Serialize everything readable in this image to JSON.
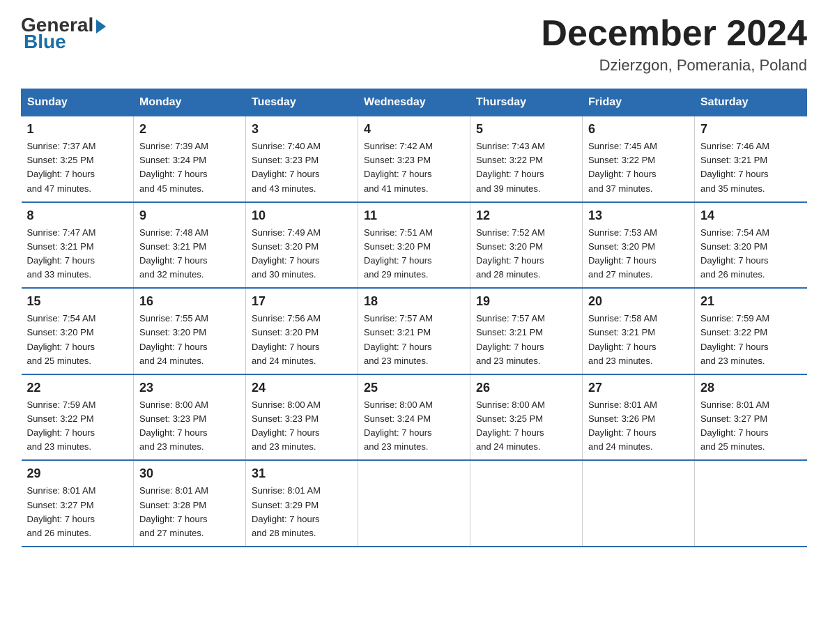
{
  "logo": {
    "general": "General",
    "blue": "Blue"
  },
  "header": {
    "month": "December 2024",
    "location": "Dzierzgon, Pomerania, Poland"
  },
  "weekdays": [
    "Sunday",
    "Monday",
    "Tuesday",
    "Wednesday",
    "Thursday",
    "Friday",
    "Saturday"
  ],
  "weeks": [
    [
      {
        "day": "1",
        "sunrise": "7:37 AM",
        "sunset": "3:25 PM",
        "daylight": "7 hours and 47 minutes."
      },
      {
        "day": "2",
        "sunrise": "7:39 AM",
        "sunset": "3:24 PM",
        "daylight": "7 hours and 45 minutes."
      },
      {
        "day": "3",
        "sunrise": "7:40 AM",
        "sunset": "3:23 PM",
        "daylight": "7 hours and 43 minutes."
      },
      {
        "day": "4",
        "sunrise": "7:42 AM",
        "sunset": "3:23 PM",
        "daylight": "7 hours and 41 minutes."
      },
      {
        "day": "5",
        "sunrise": "7:43 AM",
        "sunset": "3:22 PM",
        "daylight": "7 hours and 39 minutes."
      },
      {
        "day": "6",
        "sunrise": "7:45 AM",
        "sunset": "3:22 PM",
        "daylight": "7 hours and 37 minutes."
      },
      {
        "day": "7",
        "sunrise": "7:46 AM",
        "sunset": "3:21 PM",
        "daylight": "7 hours and 35 minutes."
      }
    ],
    [
      {
        "day": "8",
        "sunrise": "7:47 AM",
        "sunset": "3:21 PM",
        "daylight": "7 hours and 33 minutes."
      },
      {
        "day": "9",
        "sunrise": "7:48 AM",
        "sunset": "3:21 PM",
        "daylight": "7 hours and 32 minutes."
      },
      {
        "day": "10",
        "sunrise": "7:49 AM",
        "sunset": "3:20 PM",
        "daylight": "7 hours and 30 minutes."
      },
      {
        "day": "11",
        "sunrise": "7:51 AM",
        "sunset": "3:20 PM",
        "daylight": "7 hours and 29 minutes."
      },
      {
        "day": "12",
        "sunrise": "7:52 AM",
        "sunset": "3:20 PM",
        "daylight": "7 hours and 28 minutes."
      },
      {
        "day": "13",
        "sunrise": "7:53 AM",
        "sunset": "3:20 PM",
        "daylight": "7 hours and 27 minutes."
      },
      {
        "day": "14",
        "sunrise": "7:54 AM",
        "sunset": "3:20 PM",
        "daylight": "7 hours and 26 minutes."
      }
    ],
    [
      {
        "day": "15",
        "sunrise": "7:54 AM",
        "sunset": "3:20 PM",
        "daylight": "7 hours and 25 minutes."
      },
      {
        "day": "16",
        "sunrise": "7:55 AM",
        "sunset": "3:20 PM",
        "daylight": "7 hours and 24 minutes."
      },
      {
        "day": "17",
        "sunrise": "7:56 AM",
        "sunset": "3:20 PM",
        "daylight": "7 hours and 24 minutes."
      },
      {
        "day": "18",
        "sunrise": "7:57 AM",
        "sunset": "3:21 PM",
        "daylight": "7 hours and 23 minutes."
      },
      {
        "day": "19",
        "sunrise": "7:57 AM",
        "sunset": "3:21 PM",
        "daylight": "7 hours and 23 minutes."
      },
      {
        "day": "20",
        "sunrise": "7:58 AM",
        "sunset": "3:21 PM",
        "daylight": "7 hours and 23 minutes."
      },
      {
        "day": "21",
        "sunrise": "7:59 AM",
        "sunset": "3:22 PM",
        "daylight": "7 hours and 23 minutes."
      }
    ],
    [
      {
        "day": "22",
        "sunrise": "7:59 AM",
        "sunset": "3:22 PM",
        "daylight": "7 hours and 23 minutes."
      },
      {
        "day": "23",
        "sunrise": "8:00 AM",
        "sunset": "3:23 PM",
        "daylight": "7 hours and 23 minutes."
      },
      {
        "day": "24",
        "sunrise": "8:00 AM",
        "sunset": "3:23 PM",
        "daylight": "7 hours and 23 minutes."
      },
      {
        "day": "25",
        "sunrise": "8:00 AM",
        "sunset": "3:24 PM",
        "daylight": "7 hours and 23 minutes."
      },
      {
        "day": "26",
        "sunrise": "8:00 AM",
        "sunset": "3:25 PM",
        "daylight": "7 hours and 24 minutes."
      },
      {
        "day": "27",
        "sunrise": "8:01 AM",
        "sunset": "3:26 PM",
        "daylight": "7 hours and 24 minutes."
      },
      {
        "day": "28",
        "sunrise": "8:01 AM",
        "sunset": "3:27 PM",
        "daylight": "7 hours and 25 minutes."
      }
    ],
    [
      {
        "day": "29",
        "sunrise": "8:01 AM",
        "sunset": "3:27 PM",
        "daylight": "7 hours and 26 minutes."
      },
      {
        "day": "30",
        "sunrise": "8:01 AM",
        "sunset": "3:28 PM",
        "daylight": "7 hours and 27 minutes."
      },
      {
        "day": "31",
        "sunrise": "8:01 AM",
        "sunset": "3:29 PM",
        "daylight": "7 hours and 28 minutes."
      },
      null,
      null,
      null,
      null
    ]
  ],
  "labels": {
    "sunrise": "Sunrise:",
    "sunset": "Sunset:",
    "daylight": "Daylight:"
  }
}
